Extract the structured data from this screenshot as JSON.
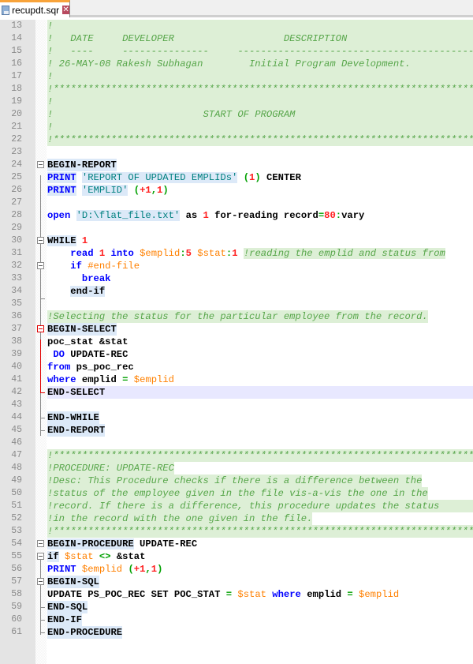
{
  "tab": {
    "filename": "recupdt.sqr",
    "close_glyph": "✕",
    "icon": "save-disk-icon"
  },
  "colors": {
    "comment": "#57a64a",
    "comment_bg": "#ddefd6",
    "keyword": "#0000ff",
    "string": "#008080",
    "number": "#ff2020",
    "variable": "#ff8000",
    "operator": "#00a000",
    "tab_accent": "#f8a33a"
  },
  "lines": [
    {
      "n": "13"
    },
    {
      "n": "14"
    },
    {
      "n": "15"
    },
    {
      "n": "16"
    },
    {
      "n": "17"
    },
    {
      "n": "18"
    },
    {
      "n": "19"
    },
    {
      "n": "20"
    },
    {
      "n": "21"
    },
    {
      "n": "22"
    },
    {
      "n": "23"
    },
    {
      "n": "24"
    },
    {
      "n": "25"
    },
    {
      "n": "26"
    },
    {
      "n": "27"
    },
    {
      "n": "28"
    },
    {
      "n": "29"
    },
    {
      "n": "30"
    },
    {
      "n": "31"
    },
    {
      "n": "32"
    },
    {
      "n": "33"
    },
    {
      "n": "34"
    },
    {
      "n": "35"
    },
    {
      "n": "36"
    },
    {
      "n": "37"
    },
    {
      "n": "38"
    },
    {
      "n": "39"
    },
    {
      "n": "40"
    },
    {
      "n": "41"
    },
    {
      "n": "42"
    },
    {
      "n": "43"
    },
    {
      "n": "44"
    },
    {
      "n": "45"
    },
    {
      "n": "46"
    },
    {
      "n": "47"
    },
    {
      "n": "48"
    },
    {
      "n": "49"
    },
    {
      "n": "50"
    },
    {
      "n": "51"
    },
    {
      "n": "52"
    },
    {
      "n": "53"
    },
    {
      "n": "54"
    },
    {
      "n": "55"
    },
    {
      "n": "56"
    },
    {
      "n": "57"
    },
    {
      "n": "58"
    },
    {
      "n": "59"
    },
    {
      "n": "60"
    },
    {
      "n": "61"
    }
  ],
  "code": {
    "l13": "!",
    "l14": "!   DATE     DEVELOPER                   DESCRIPTION",
    "l15": "!   ----     ---------------     ------------------------------------------",
    "l16": "! 26-MAY-08 Rakesh Subhagan        Initial Program Development.",
    "l17": "!",
    "l18": "!*****************************************************************************",
    "l19": "!",
    "l20": "!                          START OF PROGRAM",
    "l21": "!",
    "l22": "!*****************************************************************************",
    "l24": "BEGIN-REPORT",
    "l25": {
      "kw": "PRINT",
      "str": "'REPORT OF UPDATED EMPLIDs'",
      "p1": "(",
      "n": "1",
      "p2": ")",
      "rest": " CENTER"
    },
    "l26": {
      "kw": "PRINT",
      "str": "'EMPLID'",
      "p1": "(",
      "n1": "+1",
      "c": ",",
      "n2": "1",
      "p2": ")"
    },
    "l28": {
      "kw": "open",
      "str": "'D:\\flat_file.txt'",
      "as": " as ",
      "n": "1",
      "mid": " for-reading record",
      "eq": "=",
      "n2": "80",
      "colon": ":",
      "rest": "vary"
    },
    "l30": {
      "kw": "WHILE",
      "n": "1"
    },
    "l31": {
      "kw": "read",
      "n": "1",
      "into": "into",
      "v1": "$emplid",
      "c1": ":",
      "n1": "5",
      "v2": "$stat",
      "c2": ":",
      "n2": "1",
      "cmt": "!reading the emplid and status from"
    },
    "l32": {
      "kw": "if",
      "v": "#end-file"
    },
    "l33": "break",
    "l34": "end-if",
    "l36": "!Selecting the status for the particular employee from the record.",
    "l37": "BEGIN-SELECT",
    "l38": "poc_stat &stat",
    "l39": {
      "kw": "DO",
      "rest": " UPDATE-REC"
    },
    "l40": {
      "kw": "from",
      "rest": " ps_poc_rec"
    },
    "l41": {
      "kw": "where",
      "rest": " emplid ",
      "eq": "=",
      "v": "$emplid"
    },
    "l42": "END-SELECT",
    "l44": "END-WHILE",
    "l45": "END-REPORT",
    "l47": "!*****************************************************************************",
    "l48": "!PROCEDURE: UPDATE-REC",
    "l49": "!Desc: This Procedure checks if there is a difference between the",
    "l50": "!status of the employee given in the file vis-a-vis the one in the",
    "l51": "!record. If there is a difference, this procedure updates the status",
    "l52": "!in the record with the one given in the file.",
    "l53": "!*****************************************************************************",
    "l54": {
      "kw": "BEGIN-PROCEDURE",
      "rest": " UPDATE-REC"
    },
    "l55": {
      "kw": "if",
      "v1": "$stat",
      "op": "<>",
      "rest": " &stat"
    },
    "l56": {
      "kw": "PRINT",
      "v": "$emplid",
      "p1": "(",
      "n1": "+1",
      "c": ",",
      "n2": "1",
      "p2": ")"
    },
    "l57": "BEGIN-SQL",
    "l58": {
      "a": "UPDATE PS_POC_REC SET POC_STAT ",
      "eq": "=",
      "v1": "$stat",
      "kw": "where",
      "b": " emplid ",
      "eq2": "=",
      "v2": "$emplid"
    },
    "l59": "END-SQL",
    "l60": "END-IF",
    "l61": "END-PROCEDURE"
  }
}
